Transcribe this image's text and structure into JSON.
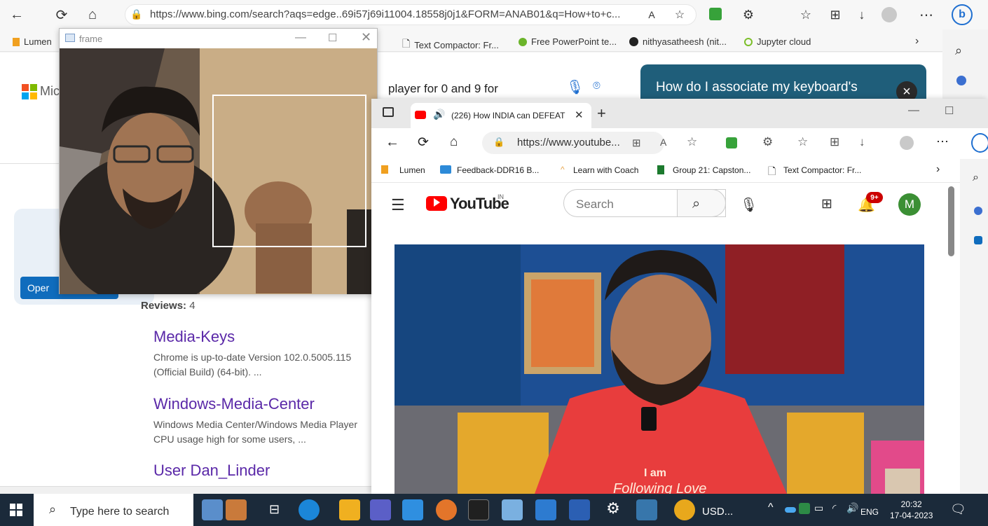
{
  "back_browser": {
    "url": "https://www.bing.com/search?aqs=edge..69i57j69i11004.18558j0j1&FORM=ANAB01&q=How+to+c...",
    "favorites": [
      "Lumen",
      "Text Compactor: Fr...",
      "Free PowerPoint te...",
      "nithyasatheesh (nit...",
      "Jupyter cloud"
    ],
    "brand_text": "Micr",
    "search_query": "player for 0 and 9 for",
    "chat_prompt": "How do I associate my keyboard's",
    "open_button": "Oper",
    "reviews_label": "Reviews:",
    "reviews_count": "4",
    "results": [
      {
        "title": "Media-Keys",
        "snippet": "Chrome is up-to-date Version 102.0.5005.115 (Official Build) (64-bit). ..."
      },
      {
        "title": "Windows-Media-Center",
        "snippet": "Windows Media Center/Windows Media Player CPU usage high for some users, ..."
      },
      {
        "title": "User Dan_Linder",
        "snippet": ""
      }
    ]
  },
  "frame_window": {
    "title": "frame"
  },
  "youtube_window": {
    "tab_title": "(226) How INDIA can DEFEAT",
    "url": "https://www.youtube...",
    "favorites": [
      "Lumen",
      "Feedback-DDR16 B...",
      "Learn with Coach",
      "Group 21: Capston...",
      "Text Compactor: Fr..."
    ],
    "logo_text": "YouTube",
    "country_code": "IN",
    "search_placeholder": "Search",
    "notification_count": "9+",
    "avatar_letter": "M",
    "video_caption_1": "I am",
    "video_caption_2": "Following Love"
  },
  "taskbar": {
    "search_placeholder": "Type here to search",
    "weather_text": "USD...",
    "language": "ENG",
    "time": "20:32",
    "date": "17-04-2023"
  },
  "colors": {
    "accent_blue": "#0f6cbd",
    "youtube_red": "#ff0000",
    "result_purple": "#5a28a8",
    "taskbar": "#1b2a3a"
  }
}
